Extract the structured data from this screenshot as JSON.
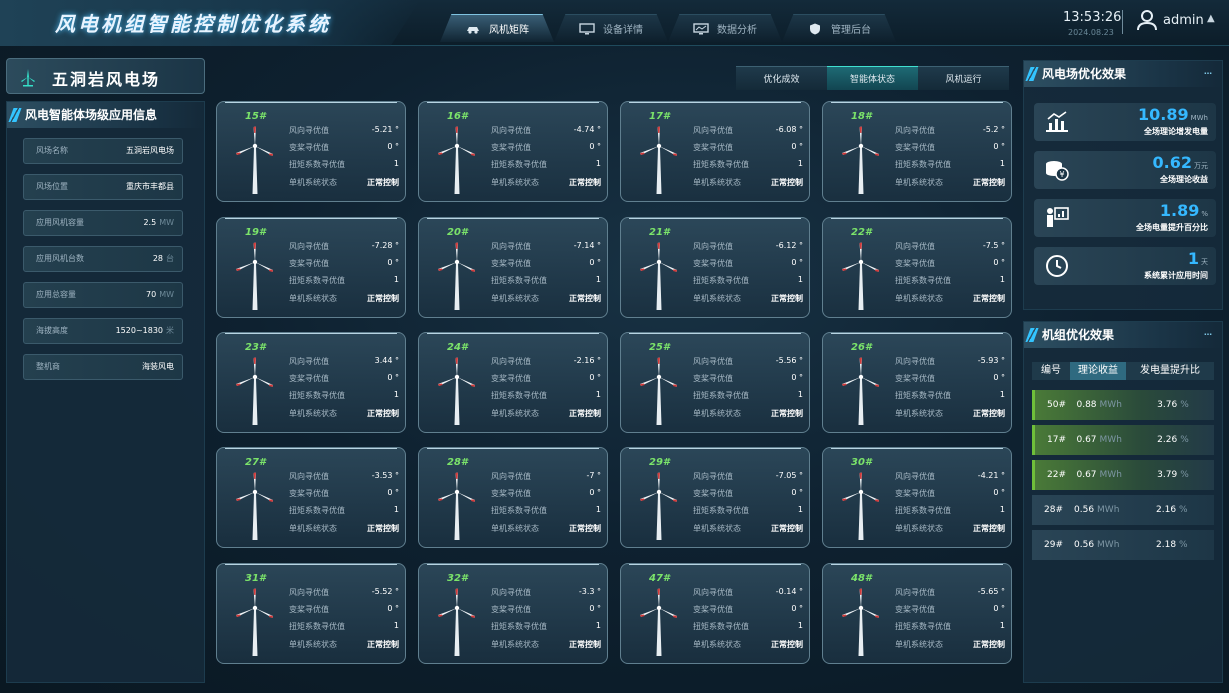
{
  "header": {
    "title": "风电机组智能控制优化系统",
    "nav": [
      {
        "label": "风机矩阵",
        "icon": "car-icon",
        "active": true
      },
      {
        "label": "设备详情",
        "icon": "monitor-icon",
        "active": false
      },
      {
        "label": "数据分析",
        "icon": "chart-monitor-icon",
        "active": false
      },
      {
        "label": "管理后台",
        "icon": "shield-icon",
        "active": false
      }
    ],
    "time": "13:53:26",
    "date": "2024.08.23",
    "user": "admin"
  },
  "farm": {
    "name": "五洞岩风电场",
    "panel_title": "风电智能体场级应用信息",
    "info": [
      {
        "key": "风场名称",
        "value": "五洞岩风电场",
        "unit": ""
      },
      {
        "key": "风场位置",
        "value": "重庆市丰都县",
        "unit": ""
      },
      {
        "key": "应用风机容量",
        "value": "2.5",
        "unit": "MW"
      },
      {
        "key": "应用风机台数",
        "value": "28",
        "unit": "台"
      },
      {
        "key": "应用总容量",
        "value": "70",
        "unit": "MW"
      },
      {
        "key": "海拔高度",
        "value": "1520~1830",
        "unit": "米"
      },
      {
        "key": "整机商",
        "value": "海装风电",
        "unit": ""
      }
    ]
  },
  "center_tabs": [
    {
      "label": "优化成效",
      "active": false
    },
    {
      "label": "智能体状态",
      "active": true
    },
    {
      "label": "风机运行",
      "active": false
    }
  ],
  "field_labels": [
    "风向寻优值",
    "变桨寻优值",
    "扭矩系数寻优值",
    "单机系统状态"
  ],
  "turbines": [
    {
      "id": "15#",
      "wind": "-5.21 °",
      "pitch": "0 °",
      "torque": "1",
      "status": "正常控制"
    },
    {
      "id": "16#",
      "wind": "-4.74 °",
      "pitch": "0 °",
      "torque": "1",
      "status": "正常控制"
    },
    {
      "id": "17#",
      "wind": "-6.08 °",
      "pitch": "0 °",
      "torque": "1",
      "status": "正常控制"
    },
    {
      "id": "18#",
      "wind": "-5.2 °",
      "pitch": "0 °",
      "torque": "1",
      "status": "正常控制"
    },
    {
      "id": "19#",
      "wind": "-7.28 °",
      "pitch": "0 °",
      "torque": "1",
      "status": "正常控制"
    },
    {
      "id": "20#",
      "wind": "-7.14 °",
      "pitch": "0 °",
      "torque": "1",
      "status": "正常控制"
    },
    {
      "id": "21#",
      "wind": "-6.12 °",
      "pitch": "0 °",
      "torque": "1",
      "status": "正常控制"
    },
    {
      "id": "22#",
      "wind": "-7.5 °",
      "pitch": "0 °",
      "torque": "1",
      "status": "正常控制"
    },
    {
      "id": "23#",
      "wind": "3.44 °",
      "pitch": "0 °",
      "torque": "1",
      "status": "正常控制"
    },
    {
      "id": "24#",
      "wind": "-2.16 °",
      "pitch": "0 °",
      "torque": "1",
      "status": "正常控制"
    },
    {
      "id": "25#",
      "wind": "-5.56 °",
      "pitch": "0 °",
      "torque": "1",
      "status": "正常控制"
    },
    {
      "id": "26#",
      "wind": "-5.93 °",
      "pitch": "0 °",
      "torque": "1",
      "status": "正常控制"
    },
    {
      "id": "27#",
      "wind": "-3.53 °",
      "pitch": "0 °",
      "torque": "1",
      "status": "正常控制"
    },
    {
      "id": "28#",
      "wind": "-7 °",
      "pitch": "0 °",
      "torque": "1",
      "status": "正常控制"
    },
    {
      "id": "29#",
      "wind": "-7.05 °",
      "pitch": "0 °",
      "torque": "1",
      "status": "正常控制"
    },
    {
      "id": "30#",
      "wind": "-4.21 °",
      "pitch": "0 °",
      "torque": "1",
      "status": "正常控制"
    },
    {
      "id": "31#",
      "wind": "-5.52 °",
      "pitch": "0 °",
      "torque": "1",
      "status": "正常控制"
    },
    {
      "id": "32#",
      "wind": "-3.3 °",
      "pitch": "0 °",
      "torque": "1",
      "status": "正常控制"
    },
    {
      "id": "47#",
      "wind": "-0.14 °",
      "pitch": "0 °",
      "torque": "1",
      "status": "正常控制"
    },
    {
      "id": "48#",
      "wind": "-5.65 °",
      "pitch": "0 °",
      "torque": "1",
      "status": "正常控制"
    }
  ],
  "farm_effect": {
    "title": "风电场优化效果",
    "stats": [
      {
        "value": "10.89",
        "unit": "MWh",
        "label": "全场理论增发电量",
        "icon": "bar-chart-icon"
      },
      {
        "value": "0.62",
        "unit": "万元",
        "label": "全场理论收益",
        "icon": "coins-icon"
      },
      {
        "value": "1.89",
        "unit": "%",
        "label": "全场电量提升百分比",
        "icon": "presenter-icon"
      },
      {
        "value": "1",
        "unit": "天",
        "label": "系统累计应用时间",
        "icon": "clock-icon"
      }
    ]
  },
  "unit_effect": {
    "title": "机组优化效果",
    "columns": [
      "编号",
      "理论收益",
      "发电量提升比"
    ],
    "active_column": 1,
    "rows": [
      {
        "id": "50#",
        "income": "0.88",
        "income_unit": "MWh",
        "lift": "3.76",
        "lift_unit": "%",
        "highlight": true
      },
      {
        "id": "17#",
        "income": "0.67",
        "income_unit": "MWh",
        "lift": "2.26",
        "lift_unit": "%",
        "highlight": true
      },
      {
        "id": "22#",
        "income": "0.67",
        "income_unit": "MWh",
        "lift": "3.79",
        "lift_unit": "%",
        "highlight": true
      },
      {
        "id": "28#",
        "income": "0.56",
        "income_unit": "MWh",
        "lift": "2.16",
        "lift_unit": "%",
        "highlight": false
      },
      {
        "id": "29#",
        "income": "0.56",
        "income_unit": "MWh",
        "lift": "2.18",
        "lift_unit": "%",
        "highlight": false
      }
    ]
  },
  "colors": {
    "accent": "#35b8ff",
    "turbine_id": "#7be36a",
    "active_tab": "#1e6a74",
    "row_highlight": "#4a7a38"
  }
}
